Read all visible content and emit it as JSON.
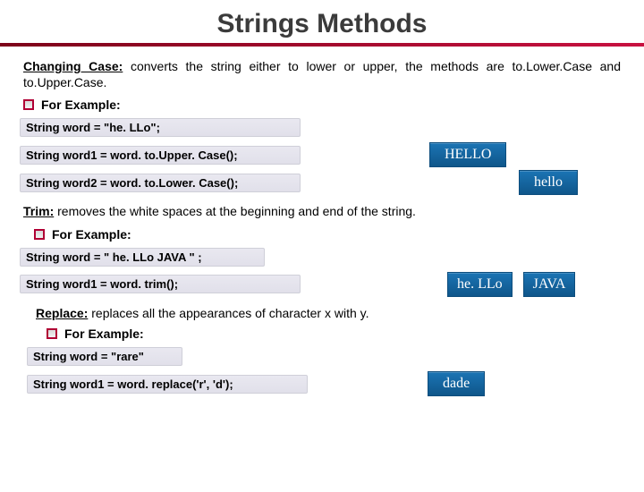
{
  "title": "Strings Methods",
  "section1": {
    "heading": "Changing Case:",
    "text": " converts the string either to lower or upper, the methods are to.Lower.Case and to.Upper.Case.",
    "example_label": "For Example:",
    "code1": "String word = \"he. LLo\";",
    "code2": "String word1 = word. to.Upper. Case();",
    "out2": "HELLO",
    "code3": "String word2 = word. to.Lower. Case();",
    "out3": "hello"
  },
  "section2": {
    "heading": "Trim:",
    "text": " removes the white spaces at the beginning and end of the string.",
    "example_label": "For Example:",
    "code1": "String word = \"   he. LLo      JAVA   \" ;",
    "code2": "String word1 = word. trim();",
    "out2a": "he. LLo",
    "out2b": "JAVA"
  },
  "section3": {
    "heading": "Replace:",
    "text": " replaces all the appearances of character x with y.",
    "example_label": "For Example:",
    "code1": "String word = \"rare\"",
    "code2": "String word1 = word. replace('r', 'd');",
    "out2": "dade"
  }
}
